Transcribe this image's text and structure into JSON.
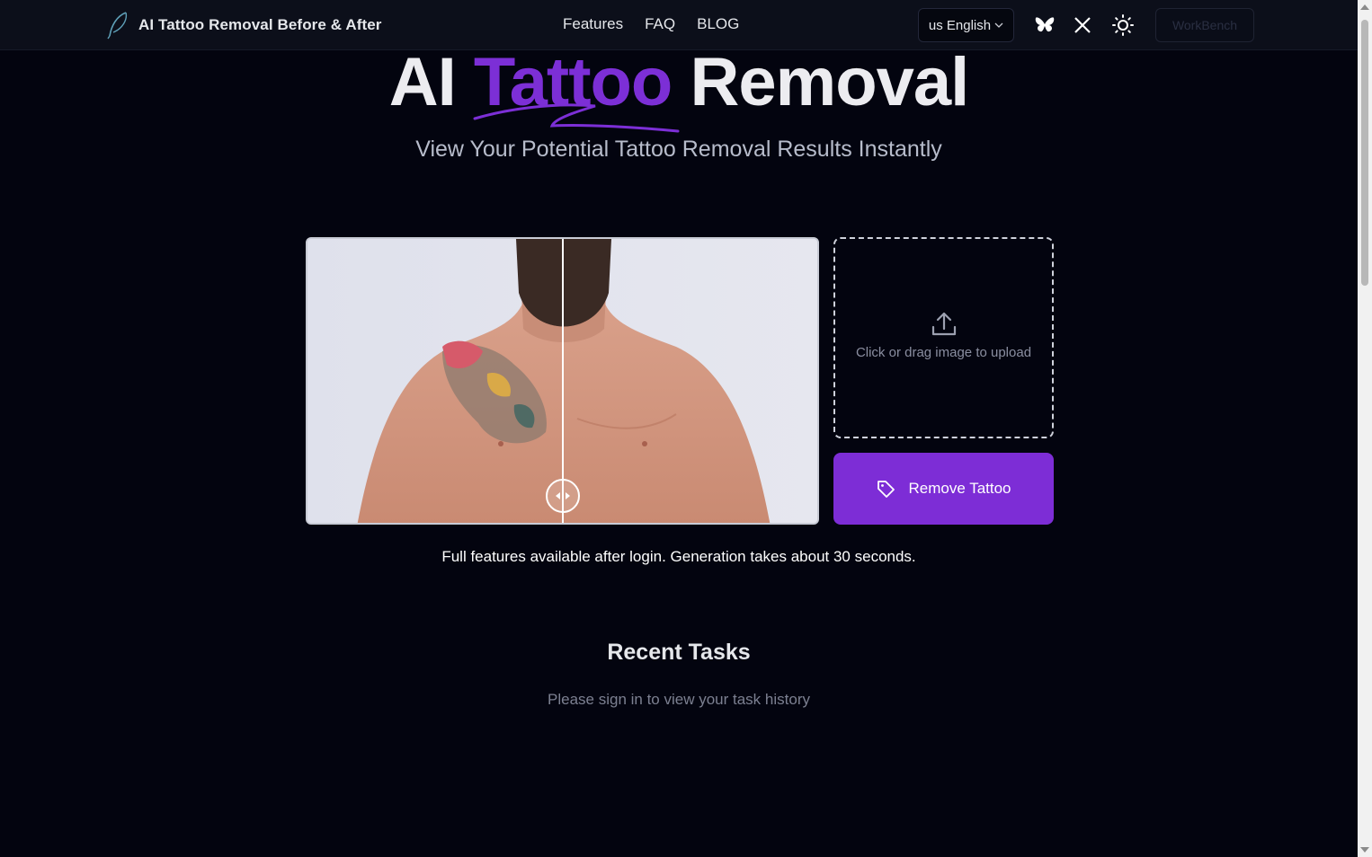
{
  "header": {
    "brand": "AI Tattoo Removal Before & After",
    "nav": [
      "Features",
      "FAQ",
      "BLOG"
    ],
    "language": "us English",
    "icons": [
      "butterfly-icon",
      "x-icon",
      "sun-icon"
    ],
    "workbench_label": "WorkBench"
  },
  "hero": {
    "title_part1": "AI",
    "title_accent": "Tattoo",
    "title_part2": "Removal",
    "subtitle": "View Your Potential Tattoo Removal Results Instantly"
  },
  "upload": {
    "label": "Click or drag image to upload"
  },
  "action": {
    "remove_label": "Remove Tattoo"
  },
  "info": "Full features available after login. Generation takes about 30 seconds.",
  "recent": {
    "title": "Recent Tasks",
    "empty_message": "Please sign in to view your task history"
  },
  "colors": {
    "background": "#03040f",
    "accent": "#7d2dd6",
    "header": "#0c0f1a"
  }
}
